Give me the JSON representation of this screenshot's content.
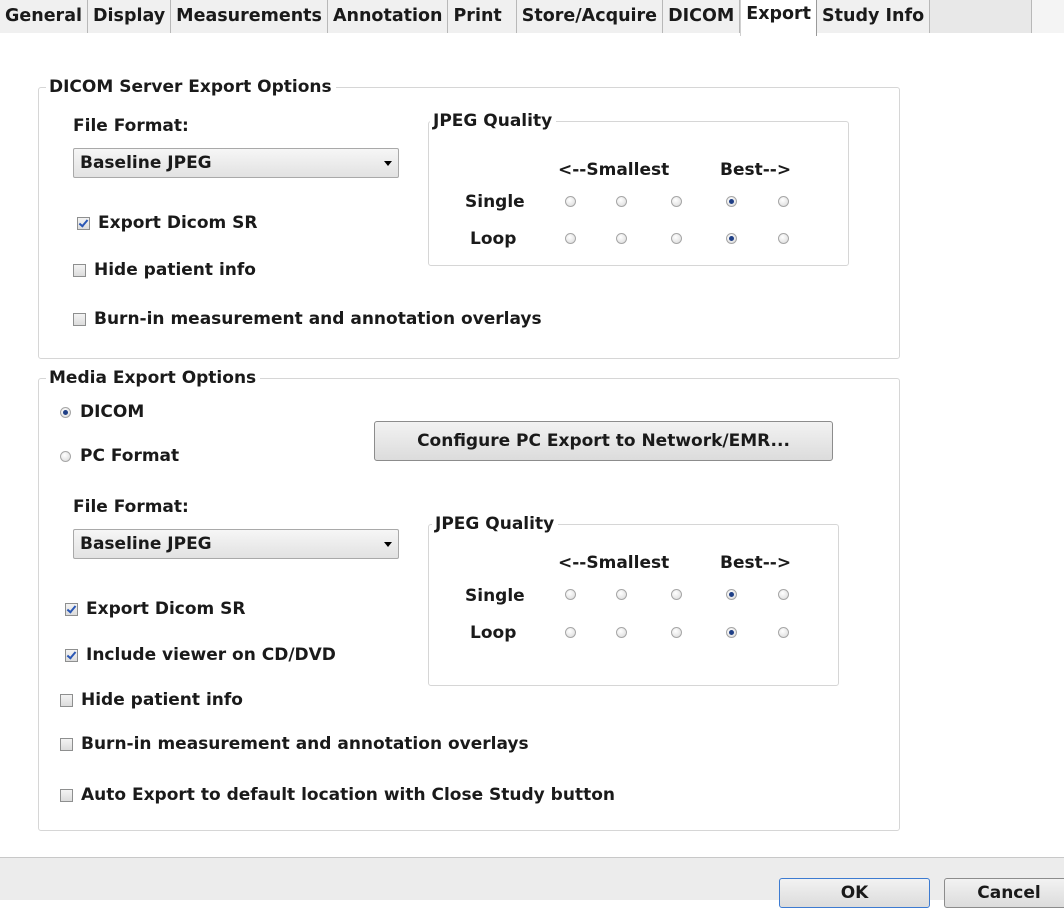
{
  "tabs": [
    "General",
    "Display",
    "Measurements",
    "Annotation",
    "Print",
    "Store/Acquire",
    "DICOM",
    "Export",
    "Study Info"
  ],
  "active_tab": "Export",
  "server": {
    "legend": "DICOM Server Export Options",
    "file_format_label": "File Format:",
    "file_format_value": "Baseline JPEG",
    "export_sr": "Export Dicom SR",
    "hide_patient": "Hide patient info",
    "burn_in": "Burn-in measurement and annotation overlays",
    "export_sr_checked": true,
    "hide_patient_checked": false,
    "burn_in_checked": false,
    "jpeg": {
      "legend": "JPEG Quality",
      "smallest": "<--Smallest",
      "best": "Best-->",
      "single_label": "Single",
      "loop_label": "Loop",
      "single_selected": 4,
      "loop_selected": 4
    }
  },
  "media": {
    "legend": "Media Export Options",
    "dicom_label": "DICOM",
    "pc_label": "PC Format",
    "selected_format": "DICOM",
    "configure_button": "Configure PC Export to Network/EMR...",
    "file_format_label": "File Format:",
    "file_format_value": "Baseline JPEG",
    "export_sr": "Export Dicom SR",
    "include_viewer": "Include viewer on CD/DVD",
    "hide_patient": "Hide patient info",
    "burn_in": "Burn-in measurement and annotation overlays",
    "auto_export": "Auto Export to default location with Close Study button",
    "export_sr_checked": true,
    "include_viewer_checked": true,
    "hide_patient_checked": false,
    "burn_in_checked": false,
    "auto_export_checked": false,
    "jpeg": {
      "legend": "JPEG Quality",
      "smallest": "<--Smallest",
      "best": "Best-->",
      "single_label": "Single",
      "loop_label": "Loop",
      "single_selected": 4,
      "loop_selected": 4
    }
  },
  "buttons": {
    "ok": "OK",
    "cancel": "Cancel"
  }
}
